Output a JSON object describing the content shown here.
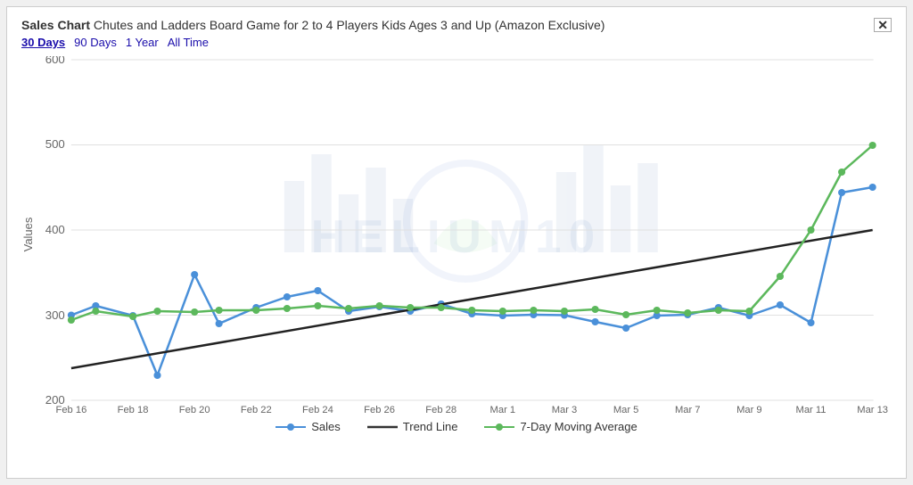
{
  "chart": {
    "title_bold": "Sales Chart",
    "title_rest": " Chutes and Ladders Board Game for 2 to 4 Players Kids Ages 3 and Up (Amazon Exclusive)",
    "time_filters": [
      {
        "label": "30 Days",
        "active": true
      },
      {
        "label": "90 Days",
        "active": false
      },
      {
        "label": "1 Year",
        "active": false
      },
      {
        "label": "All Time",
        "active": false
      }
    ],
    "y_axis_label": "Values",
    "y_axis": [
      600,
      500,
      400,
      300,
      200
    ],
    "x_labels": [
      "Feb 16",
      "Feb 18",
      "Feb 20",
      "Feb 22",
      "Feb 24",
      "Feb 26",
      "Feb 28",
      "Mar 1",
      "Mar 3",
      "Mar 5",
      "Mar 7",
      "Mar 9",
      "Mar 11",
      "Mar 13"
    ],
    "legend": [
      {
        "label": "Sales",
        "color": "#4a90d9",
        "type": "line-dot"
      },
      {
        "label": "Trend Line",
        "color": "#333333",
        "type": "line"
      },
      {
        "label": "7-Day Moving Average",
        "color": "#5cb85c",
        "type": "line-dot"
      }
    ],
    "close_label": "✕",
    "watermark": "HELIUM10"
  }
}
